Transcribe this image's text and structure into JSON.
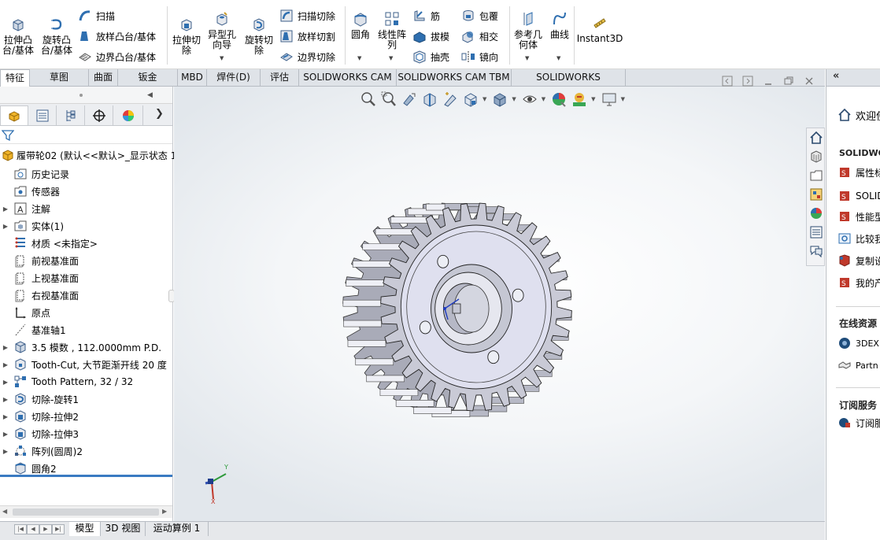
{
  "ribbon": {
    "extrude_boss": "拉伸凸\n台/基体",
    "revolve_boss": "旋转凸\n台/基体",
    "sweep": "扫描",
    "loft_boss": "放样凸台/基体",
    "boundary_boss": "边界凸台/基体",
    "extrude_cut": "拉伸切\n除",
    "hole_wizard": "异型孔\n向导",
    "revolve_cut": "旋转切\n除",
    "swept_cut": "扫描切除",
    "lofted_cut": "放样切割",
    "boundary_cut": "边界切除",
    "fillet": "圆角",
    "linear_pattern": "线性阵\n列",
    "rib": "筋",
    "draft": "拔模",
    "shell": "抽壳",
    "wrap": "包覆",
    "intersect": "相交",
    "mirror": "镜向",
    "ref_geometry": "参考几\n何体",
    "curves": "曲线",
    "instant3d": "Instant3D"
  },
  "tabs": [
    "特征",
    "草图",
    "曲面",
    "钣金",
    "MBD",
    "焊件(D)",
    "评估",
    "SOLIDWORKS CAM",
    "SOLIDWORKS CAM TBM",
    "SOLIDWORKS Inspection"
  ],
  "tree": {
    "root": "履带轮02  (默认<<默认>_显示状态 1",
    "items": [
      {
        "label": "历史记录",
        "expand": false,
        "icon": "history-folder-icon"
      },
      {
        "label": "传感器",
        "expand": false,
        "icon": "sensor-icon"
      },
      {
        "label": "注解",
        "expand": true,
        "icon": "annotations-icon"
      },
      {
        "label": "实体(1)",
        "expand": true,
        "icon": "solid-bodies-icon"
      },
      {
        "label": "材质 <未指定>",
        "expand": false,
        "icon": "material-icon"
      },
      {
        "label": "前视基准面",
        "expand": false,
        "icon": "plane-icon"
      },
      {
        "label": "上视基准面",
        "expand": false,
        "icon": "plane-icon"
      },
      {
        "label": "右视基准面",
        "expand": false,
        "icon": "plane-icon"
      },
      {
        "label": "原点",
        "expand": false,
        "icon": "origin-icon"
      },
      {
        "label": "基准轴1",
        "expand": false,
        "icon": "axis-icon"
      },
      {
        "label": "3.5 模数 , 112.0000mm P.D.",
        "expand": true,
        "icon": "gear-feature-icon"
      },
      {
        "label": "Tooth-Cut, 大节距渐开线 20 度",
        "expand": true,
        "icon": "cut-feature-icon"
      },
      {
        "label": "Tooth Pattern, 32 / 32",
        "expand": true,
        "icon": "pattern-icon"
      },
      {
        "label": "切除-旋转1",
        "expand": true,
        "icon": "revolve-cut-icon"
      },
      {
        "label": "切除-拉伸2",
        "expand": true,
        "icon": "extrude-cut-icon"
      },
      {
        "label": "切除-拉伸3",
        "expand": true,
        "icon": "extrude-cut-icon"
      },
      {
        "label": "阵列(圆周)2",
        "expand": true,
        "icon": "circular-pattern-icon"
      },
      {
        "label": "圆角2",
        "expand": false,
        "icon": "fillet-icon"
      }
    ]
  },
  "triad": {
    "x": "X",
    "y": "Y"
  },
  "taskpane": {
    "welcome": "欢迎使",
    "section1": "SOLIDWO",
    "items1": [
      "属性标",
      "SOLID",
      "性能型",
      "比较我",
      "复制设",
      "我的产"
    ],
    "section2": "在线资源",
    "items2": [
      "3DEXP",
      "Partn"
    ],
    "section3": "订阅服务",
    "items3": [
      "订阅服"
    ]
  },
  "bottom_tabs": [
    "模型",
    "3D 视图",
    "运动算例 1"
  ],
  "colors": {
    "accent": "#3a7ac2",
    "gear_face": "#dfe0ef",
    "gear_tooth": "#c9cad6"
  }
}
